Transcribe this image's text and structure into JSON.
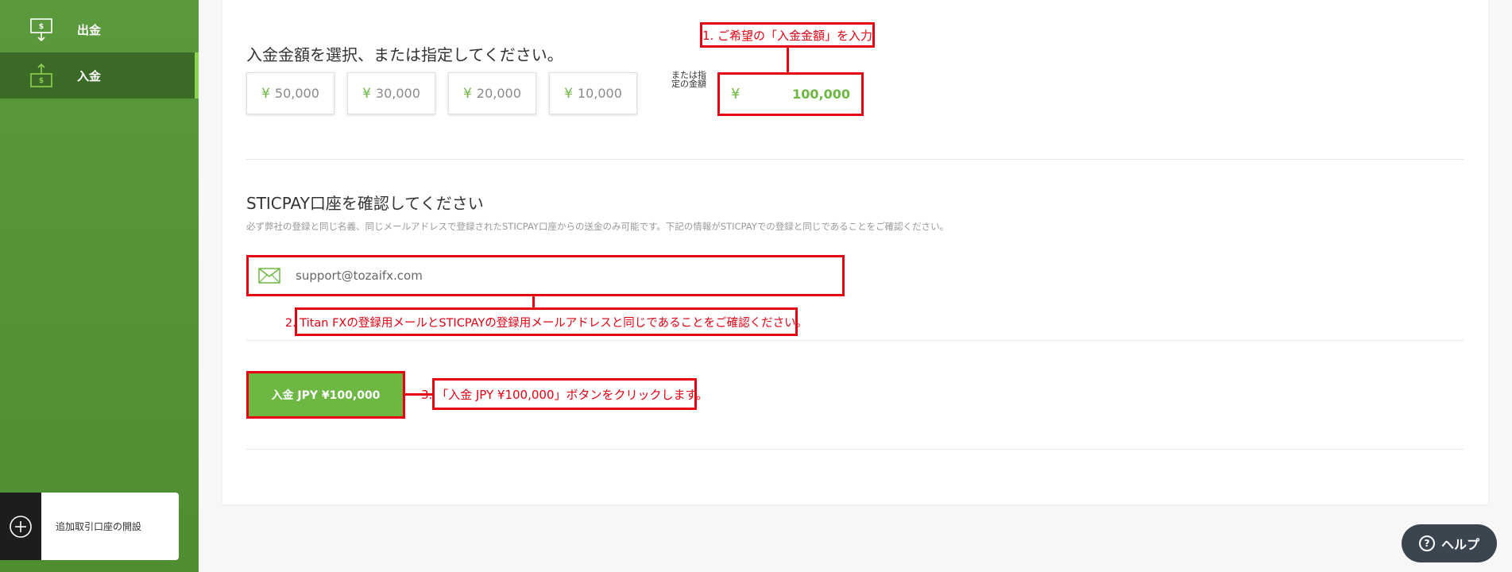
{
  "sidebar": {
    "items": [
      {
        "label": "出金",
        "icon": "withdraw-icon",
        "active": false
      },
      {
        "label": "入金",
        "icon": "deposit-icon",
        "active": true
      }
    ],
    "add_account": {
      "label": "追加取引口座の開設",
      "icon": "plus-circle-icon"
    }
  },
  "amount_section": {
    "title": "入金金額を選択、または指定してください。",
    "presets": [
      {
        "currency": "¥",
        "amount": "50,000"
      },
      {
        "currency": "¥",
        "amount": "30,000"
      },
      {
        "currency": "¥",
        "amount": "20,000"
      },
      {
        "currency": "¥",
        "amount": "10,000"
      }
    ],
    "or_label": "または指定の金額",
    "custom_currency": "¥",
    "custom_value": "100,000"
  },
  "account_section": {
    "title": "STICPAY口座を確認してください",
    "description": "必ず弊社の登録と同じ名義、同じメールアドレスで登録されたSTICPAY口座からの送金のみ可能です。下記の情報がSTICPAYでの登録と同じであることをご確認ください。",
    "email": "support@tozaifx.com"
  },
  "deposit_button": {
    "label": "入金 JPY ¥100,000"
  },
  "annotations": {
    "step1": "1. ご希望の「入金金額」を入力",
    "step2": "2. Titan FXの登録用メールとSTICPAYの登録用メールアドレスと同じであることをご確認ください。",
    "step3": "3. 「入金 JPY ¥100,000」ボタンをクリックします。"
  },
  "help": {
    "label": "ヘルプ",
    "icon": "question-circle-icon"
  },
  "colors": {
    "brand_green": "#6cb843",
    "sidebar_green": "#5b9a3c",
    "sidebar_active": "#3b6a27",
    "annotation_red": "#e60012",
    "help_bg": "#3b4550"
  }
}
